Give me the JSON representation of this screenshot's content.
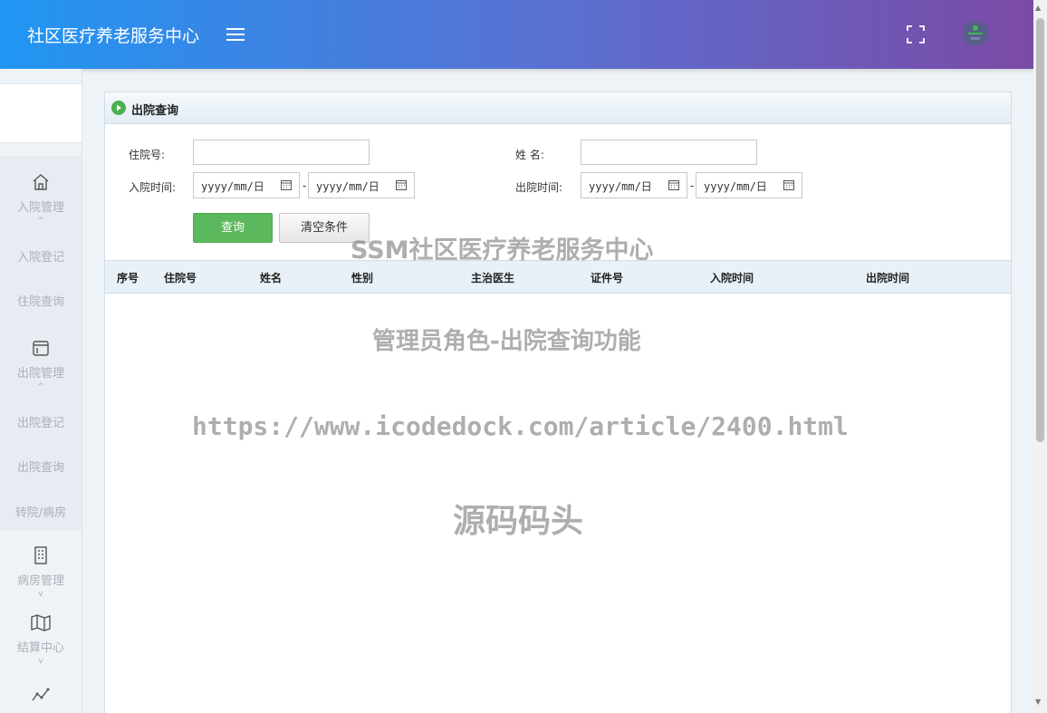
{
  "app": {
    "title": "社区医疗养老服务中心"
  },
  "sidebar": {
    "groups": [
      {
        "label": "入院管理",
        "icon": "home-icon",
        "items": [
          "入院登记",
          "住院查询"
        ]
      },
      {
        "label": "出院管理",
        "icon": "window-icon",
        "items": [
          "出院登记",
          "出院查询",
          "转院/病房"
        ]
      },
      {
        "label": "病房管理",
        "icon": "building-icon",
        "items": []
      },
      {
        "label": "结算中心",
        "icon": "map-icon",
        "items": []
      },
      {
        "label": "",
        "icon": "chart-line-icon",
        "items": []
      }
    ]
  },
  "panel": {
    "title": "出院查询"
  },
  "form": {
    "admission_no_label": "住院号:",
    "name_label": "姓 名:",
    "admit_time_label": "入院时间:",
    "discharge_time_label": "出院时间:",
    "date_placeholder": "yyyy/mm/日",
    "date_separator": "-",
    "query_button": "查询",
    "clear_button": "清空条件"
  },
  "table": {
    "columns": [
      "序号",
      "住院号",
      "姓名",
      "性别",
      "主治医生",
      "证件号",
      "入院时间",
      "出院时间"
    ]
  },
  "watermarks": [
    "SSM社区医疗养老服务中心",
    "管理员角色-出院查询功能",
    "https://www.icodedock.com/article/2400.html",
    "源码码头"
  ]
}
